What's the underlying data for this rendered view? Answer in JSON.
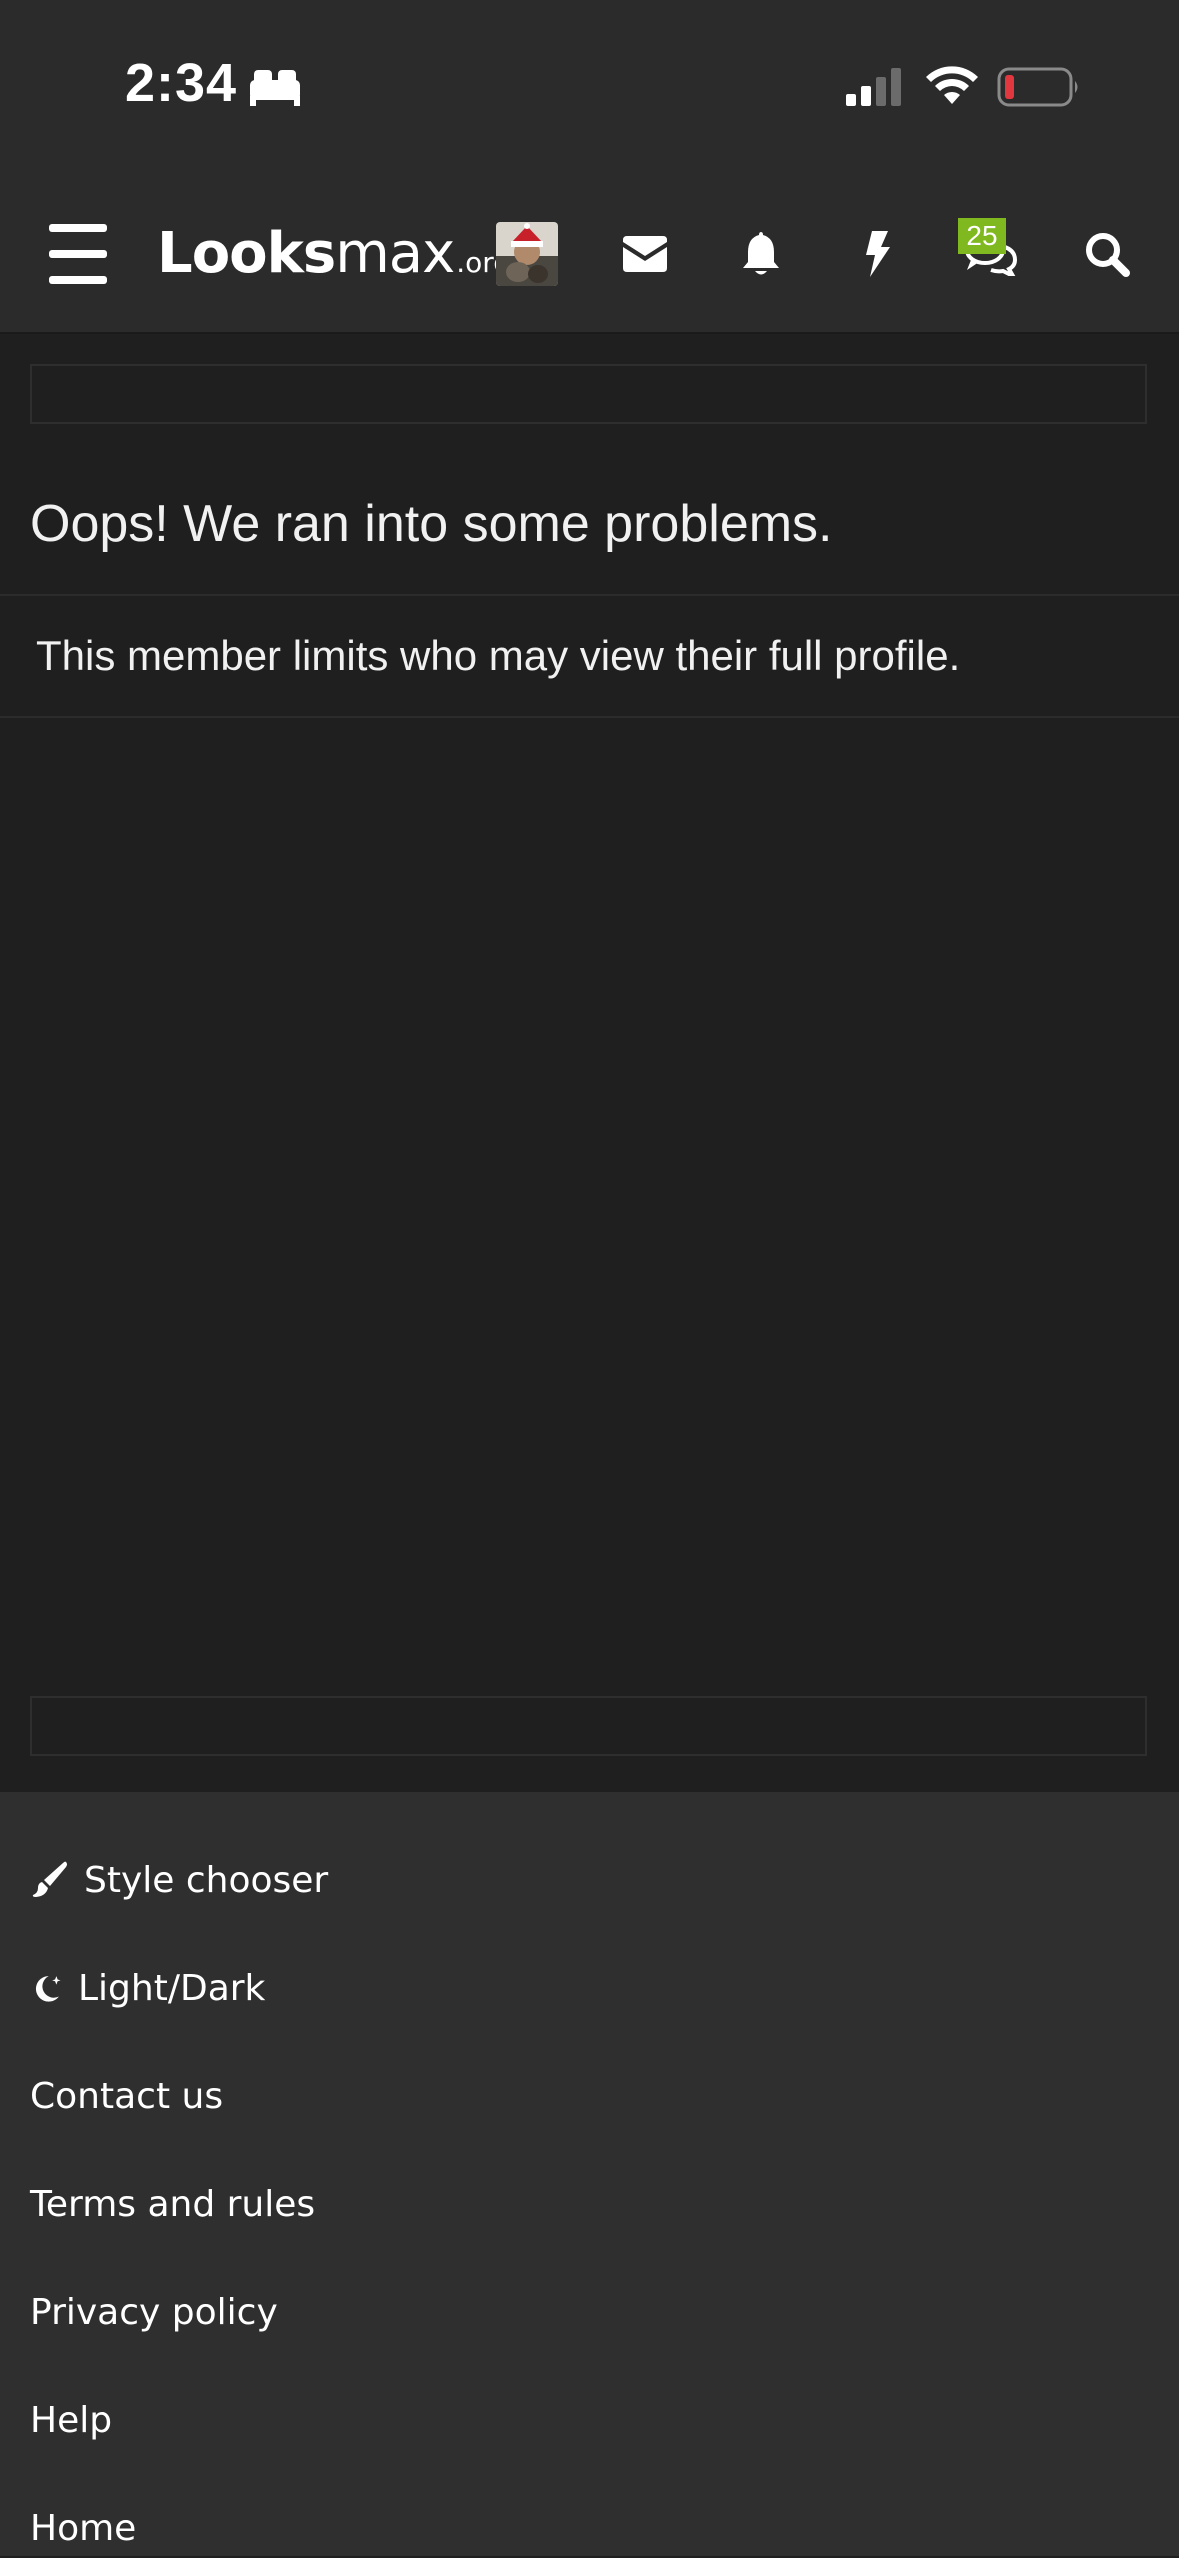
{
  "status_bar": {
    "time": "2:34",
    "icons": [
      "sleep-focus-icon",
      "cellular-signal-icon",
      "wifi-icon",
      "battery-low-icon"
    ]
  },
  "nav": {
    "logo_bold": "L",
    "logo_light": "ooks",
    "logo_bold2": "max",
    "logo_suffix": ".org",
    "icons": [
      "menu-icon",
      "avatar",
      "envelope-icon",
      "bell-icon",
      "lightning-icon",
      "chat-icon",
      "search-icon"
    ],
    "chat_badge": "25",
    "badge_color": "#7fb81f"
  },
  "main": {
    "title": "Oops! We ran into some problems.",
    "error_message": "This member limits who may view their full profile."
  },
  "footer": {
    "links": [
      {
        "label": "Style chooser",
        "icon": "paintbrush-icon"
      },
      {
        "label": "Light/Dark",
        "icon": "moon-stars-icon"
      },
      {
        "label": "Contact us"
      },
      {
        "label": "Terms and rules"
      },
      {
        "label": "Privacy policy"
      },
      {
        "label": "Help"
      },
      {
        "label": "Home"
      }
    ]
  },
  "colors": {
    "header_bg": "#2b2b2c",
    "page_bg": "#1f1f1f",
    "footer_bg": "#2f2f30",
    "battery_low": "#e0383e"
  }
}
